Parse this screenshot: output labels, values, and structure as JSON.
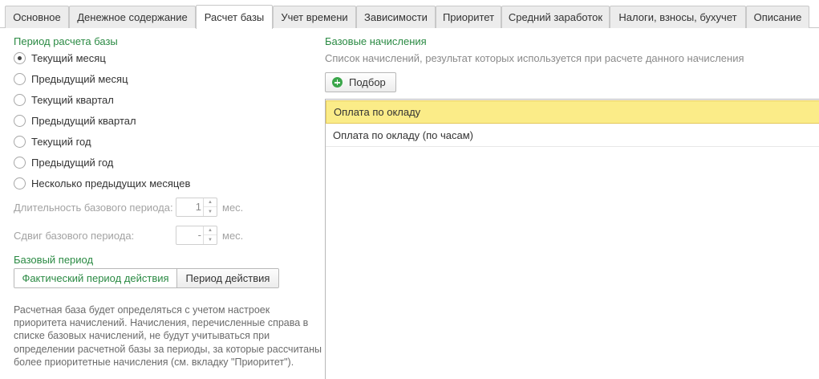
{
  "tabs": [
    {
      "label": "Основное"
    },
    {
      "label": "Денежное содержание"
    },
    {
      "label": "Расчет базы"
    },
    {
      "label": "Учет времени"
    },
    {
      "label": "Зависимости"
    },
    {
      "label": "Приоритет"
    },
    {
      "label": "Средний заработок"
    },
    {
      "label": "Налоги, взносы, бухучет"
    },
    {
      "label": "Описание"
    }
  ],
  "active_tab": "Расчет базы",
  "period": {
    "title": "Период расчета базы",
    "options": [
      {
        "label": "Текущий месяц",
        "checked": true
      },
      {
        "label": "Предыдущий месяц",
        "checked": false
      },
      {
        "label": "Текущий квартал",
        "checked": false
      },
      {
        "label": "Предыдущий квартал",
        "checked": false
      },
      {
        "label": "Текущий год",
        "checked": false
      },
      {
        "label": "Предыдущий год",
        "checked": false
      },
      {
        "label": "Несколько предыдущих месяцев",
        "checked": false
      }
    ],
    "duration": {
      "label": "Длительность базового периода:",
      "value": "1",
      "unit": "мес."
    },
    "shift": {
      "label": "Сдвиг базового периода:",
      "value": "-",
      "unit": "мес."
    }
  },
  "base_period": {
    "title": "Базовый период",
    "options": [
      "Фактический период действия",
      "Период действия"
    ],
    "selected": "Фактический период действия",
    "note": "Расчетная база будет определяться с учетом настроек приоритета начислений. Начисления, перечисленные справа в списке базовых начислений, не будут учитываться при определении расчетной базы за периоды, за которые рассчитаны более приоритетные начисления (см. вкладку \"Приоритет\")."
  },
  "base_accruals": {
    "title": "Базовые начисления",
    "description": "Список начислений, результат которых используется при расчете данного начисления",
    "pick_button": "Подбор",
    "rows": [
      {
        "label": "Оплата по окладу",
        "selected": true
      },
      {
        "label": "Оплата по окладу (по часам)",
        "selected": false
      }
    ]
  },
  "colors": {
    "accent_green": "#2a8a43",
    "selection": "#fbec88"
  }
}
